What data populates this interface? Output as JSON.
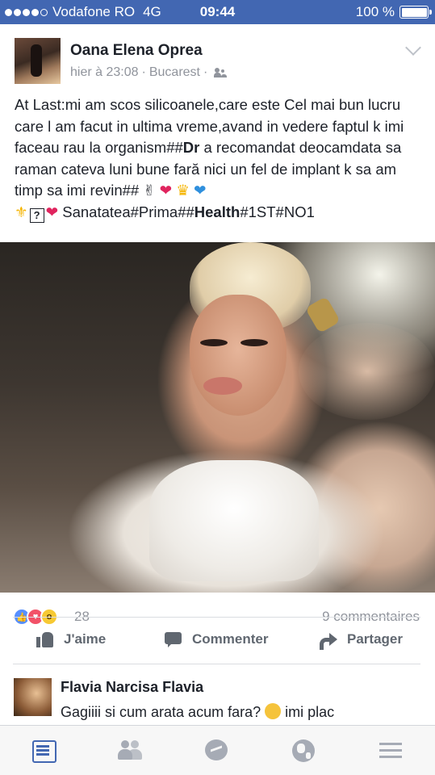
{
  "status_bar": {
    "carrier": "Vodafone RO",
    "network": "4G",
    "time": "09:44",
    "battery": "100 %",
    "battery_level": 1.0,
    "signal_bars_filled": 4,
    "signal_bars_total": 5
  },
  "post": {
    "author": "Oana Elena Oprea",
    "time": "hier à 23:08",
    "separator": "·",
    "location": "Bucarest",
    "audience_icon": "friends-icon",
    "text": {
      "part1": "At Last:mi am scos silicoanele,care este Cel mai bun lucru care l am facut in ultima vreme,avand in vedere faptul k imi faceau rau la organism##",
      "bold1": "Dr",
      "part2": " a recomandat deocamdata sa raman cateva luni bune fară nici un fel de implant k sa am timp sa imi revin## ",
      "line2_start": " Sanatatea#Prima##",
      "bold2": "Health",
      "line2_end": "#1ST#NO1"
    },
    "photo_alt_icon": "photo"
  },
  "reactions": {
    "count": "28",
    "comments": "9 commentaires",
    "types": [
      "like",
      "love",
      "wow"
    ]
  },
  "actions": {
    "like": "J'aime",
    "comment": "Commenter",
    "share": "Partager"
  },
  "comment": {
    "author": "Flavia Narcisa Flavia",
    "text_before": "Gagiiii si cum arata acum fara? ",
    "text_after": "imi plac"
  },
  "bottom_nav": {
    "items": [
      "news-feed",
      "friends",
      "messenger",
      "notifications",
      "menu"
    ],
    "active": "news-feed",
    "active_color": "#4267b2",
    "inactive_color": "#a6abb5"
  },
  "colors": {
    "brand": "#4267b2",
    "text": "#1d2129",
    "muted": "#90949c"
  }
}
